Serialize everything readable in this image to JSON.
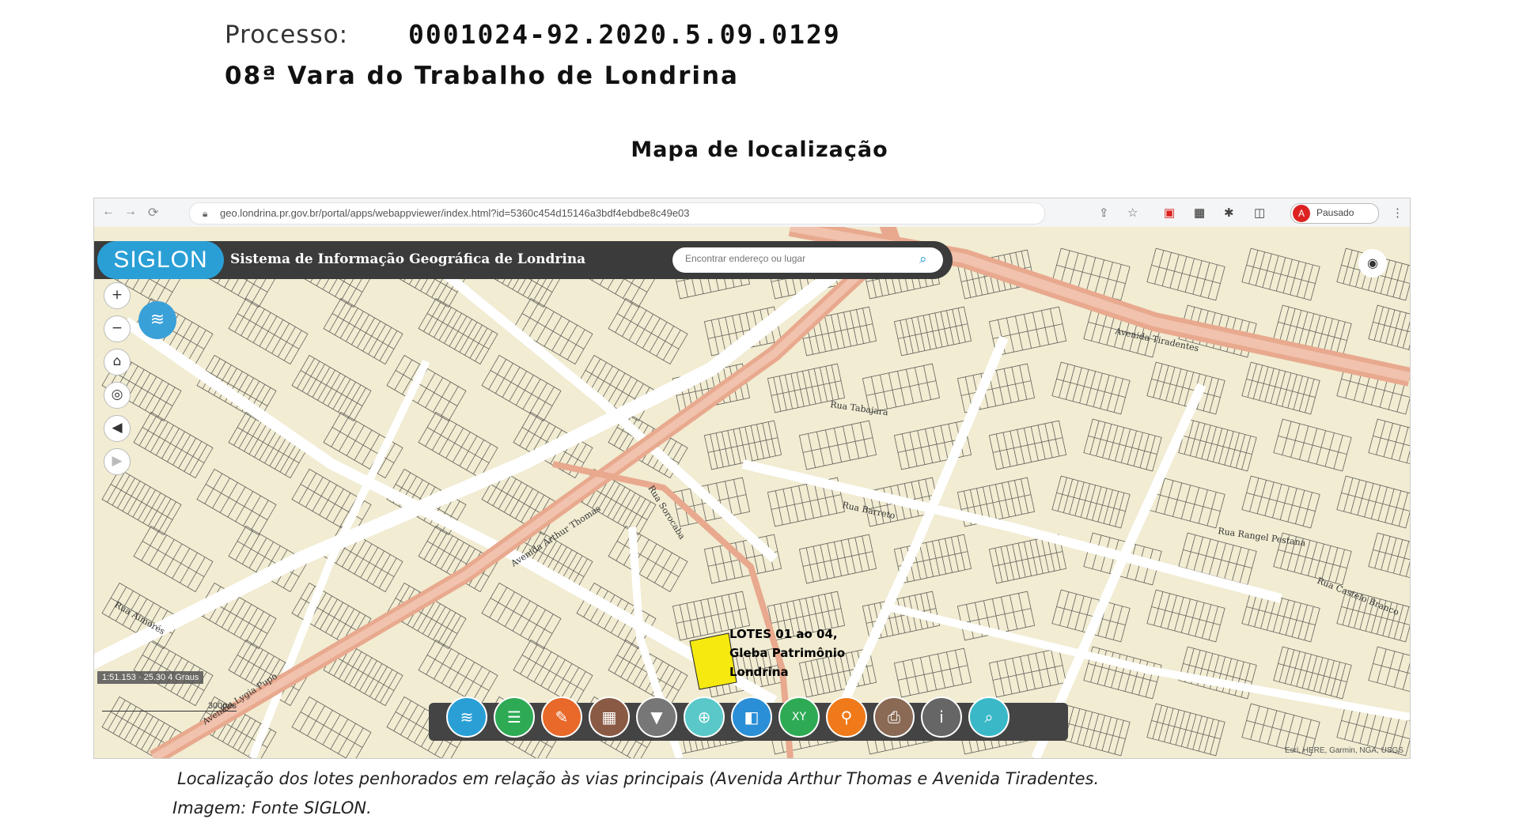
{
  "header": {
    "process_label": "Processo:",
    "process_number": "0001024-92.2020.5.09.0129",
    "court": "08ª Vara do Trabalho de Londrina",
    "map_title": "Mapa de localização"
  },
  "browser": {
    "url": "geo.londrina.pr.gov.br/portal/apps/webappviewer/index.html?id=5360c454d15146a3bdf4ebdbe8c49e03",
    "profile_initial": "A",
    "profile_label": "Pausado"
  },
  "app": {
    "logo_text": "SIGLON",
    "title": "Sistema de Informação Geográfica de Londrina",
    "search_placeholder": "Encontrar endereço ou lugar"
  },
  "map": {
    "scale_text": "1:51.153 · 25.30 4 Graus",
    "scalebar_text": "300pés",
    "attribution": "Esri, HERE, Garmin, NGA, USGS",
    "esri_logo": "esri",
    "lot_label_lines": [
      "LOTES 01 ao 04,",
      "Gleba Patrimônio",
      "Londrina"
    ],
    "highlight_color": "#f5e90f",
    "street_labels": [
      "Avenida Arthur Thomas",
      "Avenida Tiradentes",
      "Rua Rangel Pestana",
      "Rua Barreto",
      "Rua Tabajara",
      "Rua Aimorés",
      "Rua Castelo Branco",
      "Avenida Lygia Pupo",
      "Rua Sorocaba"
    ]
  },
  "toolbar": {
    "tools": [
      {
        "name": "layers-tool",
        "color": "#2a9fd6",
        "icon": "≋"
      },
      {
        "name": "legend-tool",
        "color": "#2eaa55",
        "icon": "☰"
      },
      {
        "name": "measure-tool",
        "color": "#e8692a",
        "icon": "✎"
      },
      {
        "name": "basemap-tool",
        "color": "#8a5a44",
        "icon": "▦"
      },
      {
        "name": "filter-tool",
        "color": "#777777",
        "icon": "▼"
      },
      {
        "name": "draw-tool",
        "color": "#5ac8c8",
        "icon": "⊕"
      },
      {
        "name": "swipe-tool",
        "color": "#2a8fd6",
        "icon": "◧"
      },
      {
        "name": "coordinate-tool",
        "color": "#2eaa55",
        "icon": "XY"
      },
      {
        "name": "share-tool",
        "color": "#f07a1a",
        "icon": "⚲"
      },
      {
        "name": "print-tool",
        "color": "#8a6a55",
        "icon": "⎙"
      },
      {
        "name": "about-tool",
        "color": "#666666",
        "icon": "i"
      },
      {
        "name": "search-tool",
        "color": "#3ab8c8",
        "icon": "⌕"
      }
    ]
  },
  "caption": {
    "line1": "Localização dos lotes penhorados em relação às vias principais (Avenida Arthur Thomas e Avenida Tiradentes.",
    "line2": "Imagem: Fonte SIGLON."
  }
}
